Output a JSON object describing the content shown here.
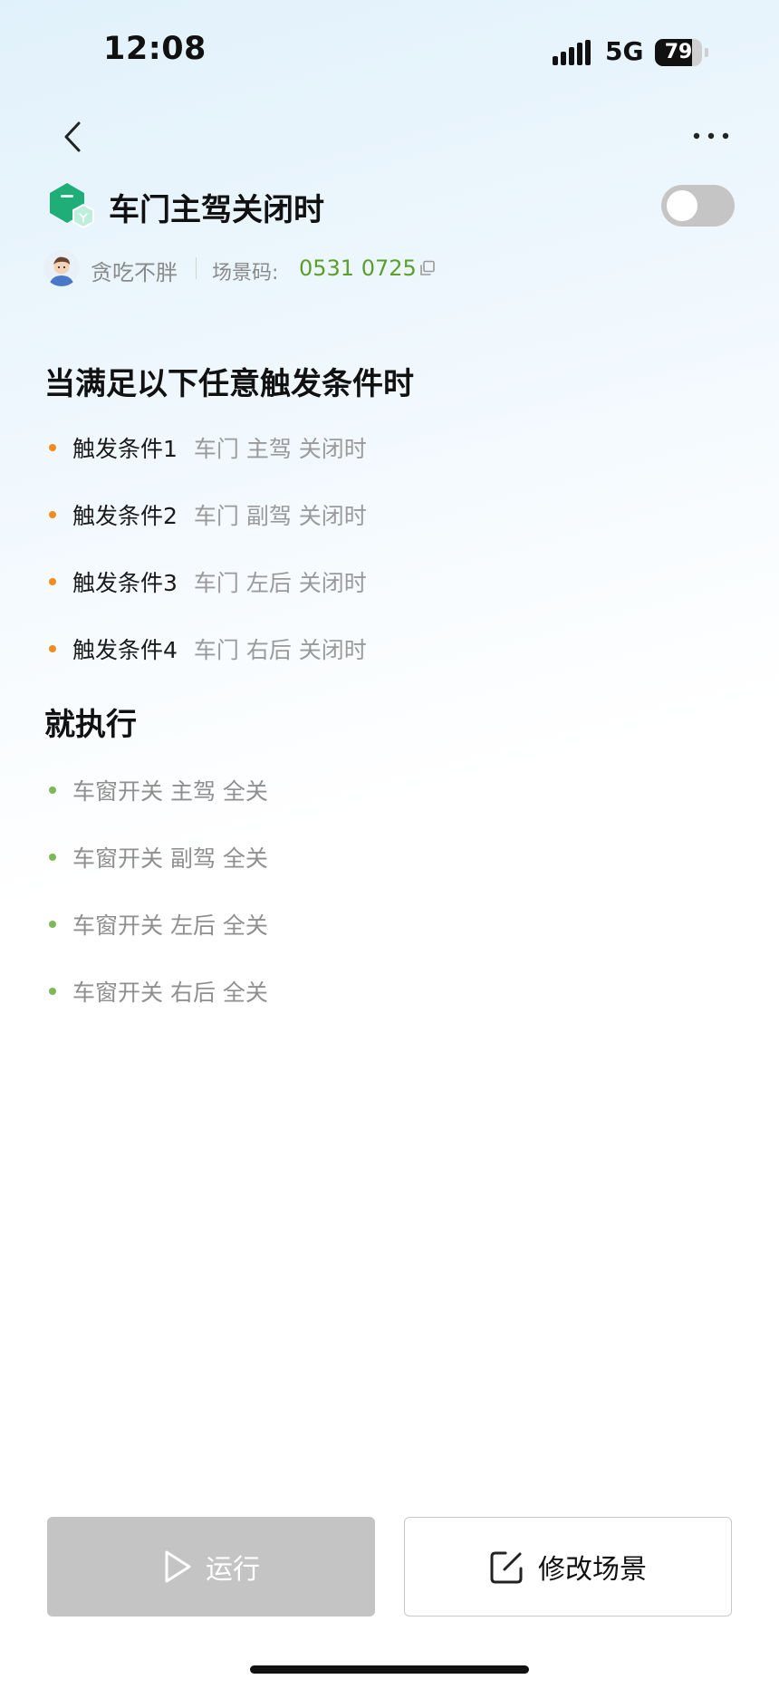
{
  "status_bar": {
    "time": "12:08",
    "network": "5G",
    "battery": "79",
    "battery_level": 0.79
  },
  "nav": {
    "back_icon": "chevron-left-icon",
    "more_icon": "more-dots-icon"
  },
  "scene": {
    "title": "车门主驾关闭时",
    "enabled": false,
    "author": "贪吃不胖",
    "code_label": "场景码:",
    "code_value": "0531 0725"
  },
  "conditions": {
    "heading": "当满足以下任意触发条件时",
    "items": [
      {
        "name": "触发条件1",
        "detail": "车门 主驾 关闭时"
      },
      {
        "name": "触发条件2",
        "detail": "车门 副驾 关闭时"
      },
      {
        "name": "触发条件3",
        "detail": "车门 左后 关闭时"
      },
      {
        "name": "触发条件4",
        "detail": "车门 右后 关闭时"
      }
    ]
  },
  "actions": {
    "heading": "就执行",
    "items": [
      {
        "text": "车窗开关 主驾 全关"
      },
      {
        "text": "车窗开关 副驾 全关"
      },
      {
        "text": "车窗开关 左后 全关"
      },
      {
        "text": "车窗开关 右后 全关"
      }
    ]
  },
  "buttons": {
    "run": "运行",
    "edit": "修改场景"
  },
  "colors": {
    "accent_green": "#5c9e2b",
    "condition_dot": "#f08c1e",
    "action_dot": "#7cb857"
  }
}
